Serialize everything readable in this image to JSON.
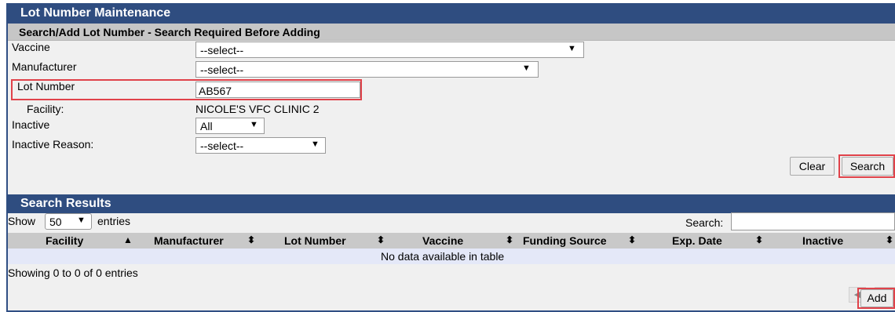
{
  "header": {
    "title": "Lot Number Maintenance"
  },
  "search_form": {
    "title": "Search/Add Lot Number - Search Required Before Adding",
    "vaccine": {
      "label": "Vaccine",
      "value": "--select--"
    },
    "manufacturer": {
      "label": "Manufacturer",
      "value": "--select--"
    },
    "lot_number": {
      "label": "Lot Number",
      "value": "AB567"
    },
    "facility": {
      "label": "Facility:",
      "value": "NICOLE'S VFC CLINIC 2"
    },
    "inactive": {
      "label": "Inactive",
      "value": "All"
    },
    "inactive_reason": {
      "label": "Inactive Reason:",
      "value": "--select--"
    },
    "clear_label": "Clear",
    "search_label": "Search"
  },
  "results": {
    "title": "Search Results",
    "show_prefix": "Show",
    "page_size": "50",
    "show_suffix": "entries",
    "search_label": "Search:",
    "search_value": "",
    "columns": [
      "Facility",
      "Manufacturer",
      "Lot Number",
      "Vaccine",
      "Funding Source",
      "Exp. Date",
      "Inactive"
    ],
    "empty_message": "No data available in table",
    "info": "Showing 0 to 0 of 0 entries",
    "add_label": "Add"
  },
  "icons": {
    "dropdown": "triangle-down",
    "sort_asc": "triangle-up",
    "sort_both": "up-down-arrows",
    "prev": "triangle-left",
    "next": "triangle-right"
  },
  "colors": {
    "header_bg": "#2f4d80",
    "highlight": "#e0424a",
    "empty_row_bg": "#e4e8f8"
  }
}
